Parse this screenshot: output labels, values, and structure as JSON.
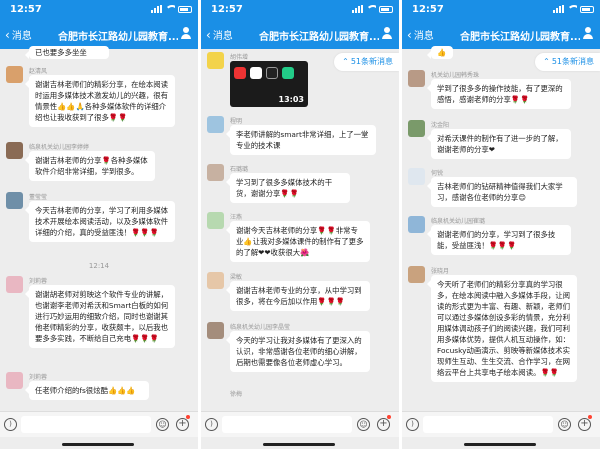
{
  "colors": {
    "accent": "#1a8fe6",
    "chat_bg": "#ededed",
    "bubble": "#ffffff"
  },
  "panels": [
    {
      "status": {
        "time": "12:57"
      },
      "nav": {
        "back_label": "消息",
        "title": "合肥市长江路幼儿园教育...(176)"
      },
      "unread_badge": "",
      "timestamp": "12:14",
      "messages": [
        {
          "sender": "",
          "text": "已也要多多坐坐"
        },
        {
          "sender": "赵清风",
          "text": "谢谢吉林老师们的精彩分享，在绘本阅读时运用多媒体技术激发幼儿的兴趣，很有情景性👍👍🙏各种多媒体软件的详细介绍也让我收获到了很多🌹🌹"
        },
        {
          "sender": "临泉机关幼儿园李婷婷",
          "text": "谢谢吉林老师的分享🌹各种多媒体软件介绍非常详细，学到很多。"
        },
        {
          "sender": "董莹莹",
          "text": "今天吉林老师的分享，学习了利用多媒体技术开展绘本阅读活动，以及多媒体软件详细的介绍，真的受益匪浅！🌹🌹🌹"
        },
        {
          "sender": "刘莉蓉",
          "text": "谢谢胡老师对剪映这个软件专业的讲解，也谢谢李老师对希沃和Smart白板的如何进行巧妙运用的细致介绍，同时也谢谢其他老师精彩的分享，收获颇丰，以后我也要多多实践，不断给自己充电🌹🌹🌹"
        },
        {
          "sender": "刘莉蓉",
          "text": "任老师介绍的fs很炫酷👍👍👍"
        }
      ]
    },
    {
      "status": {
        "time": "12:57"
      },
      "nav": {
        "back_label": "消息",
        "title": "合肥市长江路幼儿园教育...(176)"
      },
      "unread_badge": "51条新消息",
      "media_time": "13:03",
      "messages": [
        {
          "sender": "胡伟增",
          "text": ""
        },
        {
          "sender": "程明",
          "text": "李老师讲解的smart非常详细，上了一堂专业的技术课"
        },
        {
          "sender": "石璐璐",
          "text": "学习到了很多多媒体技术的干货，谢谢分享🌹🌹"
        },
        {
          "sender": "汪燕",
          "text": "谢谢今天吉林老师的分享🌹🌹非常专业👍让我对多媒体课件的制作有了更多的了解❤❤收获很大🌺"
        },
        {
          "sender": "梁敏",
          "text": "谢谢吉林老师专业的分享，从中学习到很多，将在今后加以作用🌹🌹🌹"
        },
        {
          "sender": "临泉机关幼儿园李晶莹",
          "text": "今天的学习让我对多媒体有了更深入的认识，非常感谢各位老师的细心讲解，后期也需要像各位老师虚心学习。"
        },
        {
          "sender": "徐梅",
          "text": ""
        }
      ]
    },
    {
      "status": {
        "time": "12:57"
      },
      "nav": {
        "back_label": "消息",
        "title": "合肥市长江路幼儿园教育...(176)"
      },
      "unread_badge": "51条新消息",
      "messages": [
        {
          "sender": "",
          "text": "👍"
        },
        {
          "sender": "机关幼儿园韩秀珠",
          "text": "学到了很多多的操作技能，有了更深的感悟，感谢老师的分享🌹🌹"
        },
        {
          "sender": "沈金阳",
          "text": "对希沃课件的制作有了进一步的了解，谢谢老师的分享❤"
        },
        {
          "sender": "何锐",
          "text": "吉林老师们的钻研精神值得我们大家学习，感谢各位老师的分享😊"
        },
        {
          "sender": "临泉机关幼儿园崔璐",
          "text": "谢谢老师们的分享，学习到了很多技能，受益匪浅！🌹🌹🌹"
        },
        {
          "sender": "张晓月",
          "text": "今天听了老师们的精彩分享真的学习很多，在绘本阅读中融入多媒体手段，让阅读的形式更为丰富、有趣、新颖，老师们可以通过多媒体创设多彩的情景，充分利用媒体调动孩子们的阅读兴趣，我们可利用多媒体优势，提供人机互动操作，如：Focusky动画演示、剪映等新媒体技术实现师生互动、生生交流、合作学习，在网络云平台上共享电子绘本阅读。🌹🌹"
        }
      ]
    }
  ]
}
